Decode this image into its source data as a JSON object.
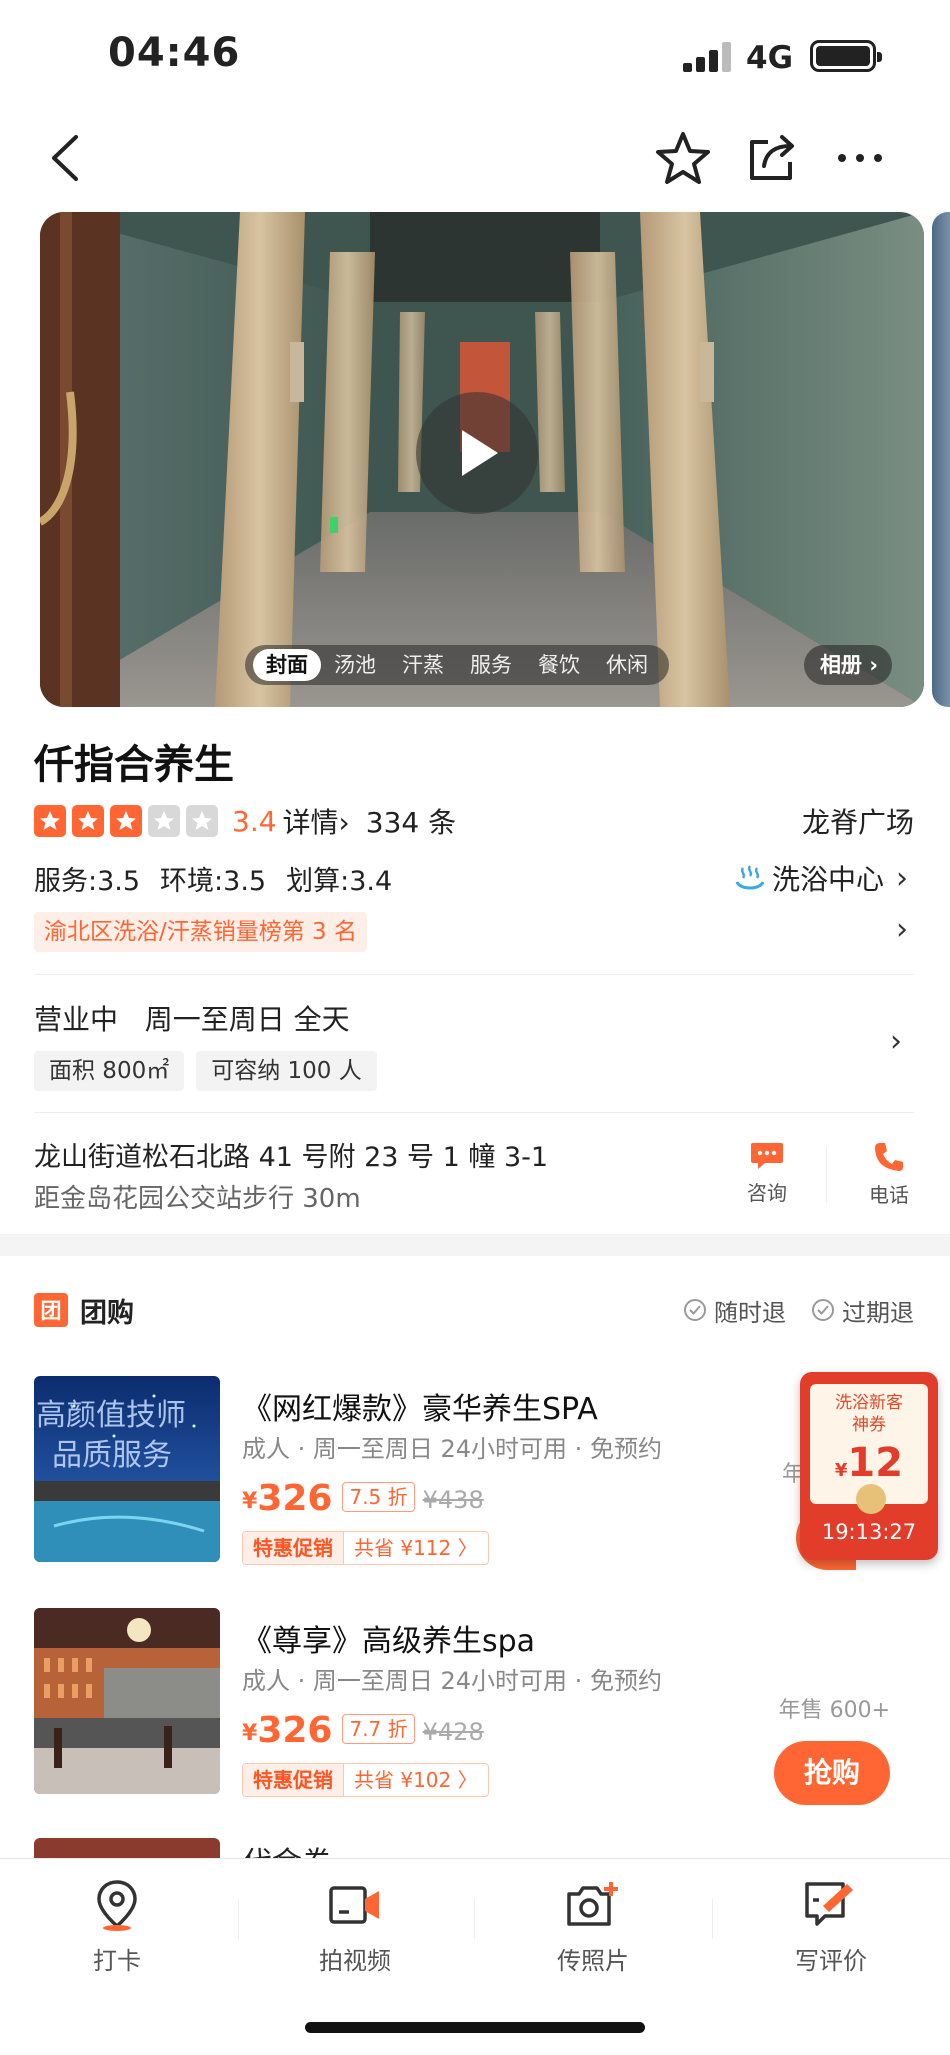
{
  "status": {
    "time": "04:46",
    "network": "4G"
  },
  "hero": {
    "tabs": [
      "封面",
      "汤池",
      "汗蒸",
      "服务",
      "餐饮",
      "休闲"
    ],
    "album": "相册"
  },
  "shop": {
    "name": "仟指合养生",
    "rating": 3.4,
    "rating_text": "3.4",
    "stars_filled": 3,
    "stars_total": 5,
    "detail_link": "详情",
    "review_count": "334 条",
    "region": "龙脊广场",
    "subscores": [
      "服务:3.5",
      "环境:3.5",
      "划算:3.4"
    ],
    "category": "洗浴中心",
    "rank_tag": "渝北区洗浴/汗蒸销量榜第 3 名",
    "hours": "营业中   周一至周日 全天",
    "tags": [
      "面积 800㎡",
      "可容纳 100 人"
    ],
    "address": "龙山街道松石北路 41 号附 23 号 1 幢 3-1",
    "distance": "距金岛花园公交站步行 30m",
    "consult": "咨询",
    "phone": "电话"
  },
  "group_buy": {
    "title": "团购",
    "icon_char": "团",
    "policies": [
      "随时退",
      "过期退"
    ],
    "deals": [
      {
        "thumb_text_1": "高颜值技师",
        "thumb_text_2": "品质服务",
        "title": "《网红爆款》豪华养生SPA",
        "sub": "成人 · 周一至周日 24小时可用 · 免预约",
        "currency": "¥",
        "price": "326",
        "discount": "7.5 折",
        "orig_price": "¥438",
        "promo_label": "特惠促销",
        "promo_save": "共省 ¥112 〉",
        "sales": "年",
        "buy": ""
      },
      {
        "title": "《尊享》高级养生spa",
        "sub": "成人 · 周一至周日 24小时可用 · 免预约",
        "currency": "¥",
        "price": "326",
        "discount": "7.7 折",
        "orig_price": "¥428",
        "promo_label": "特惠促销",
        "promo_save": "共省 ¥102 〉",
        "sales": "年售 600+",
        "buy": "抢购"
      }
    ],
    "peek_title": "代金券"
  },
  "coupon": {
    "title_1": "洗浴新客",
    "title_2": "神券",
    "symbol": "¥",
    "value": "12",
    "timer": "19:13:27"
  },
  "bottom_tabs": [
    "打卡",
    "拍视频",
    "传照片",
    "写评价"
  ],
  "colors": {
    "accent": "#ff6633",
    "coupon_red": "#e23c2a"
  }
}
